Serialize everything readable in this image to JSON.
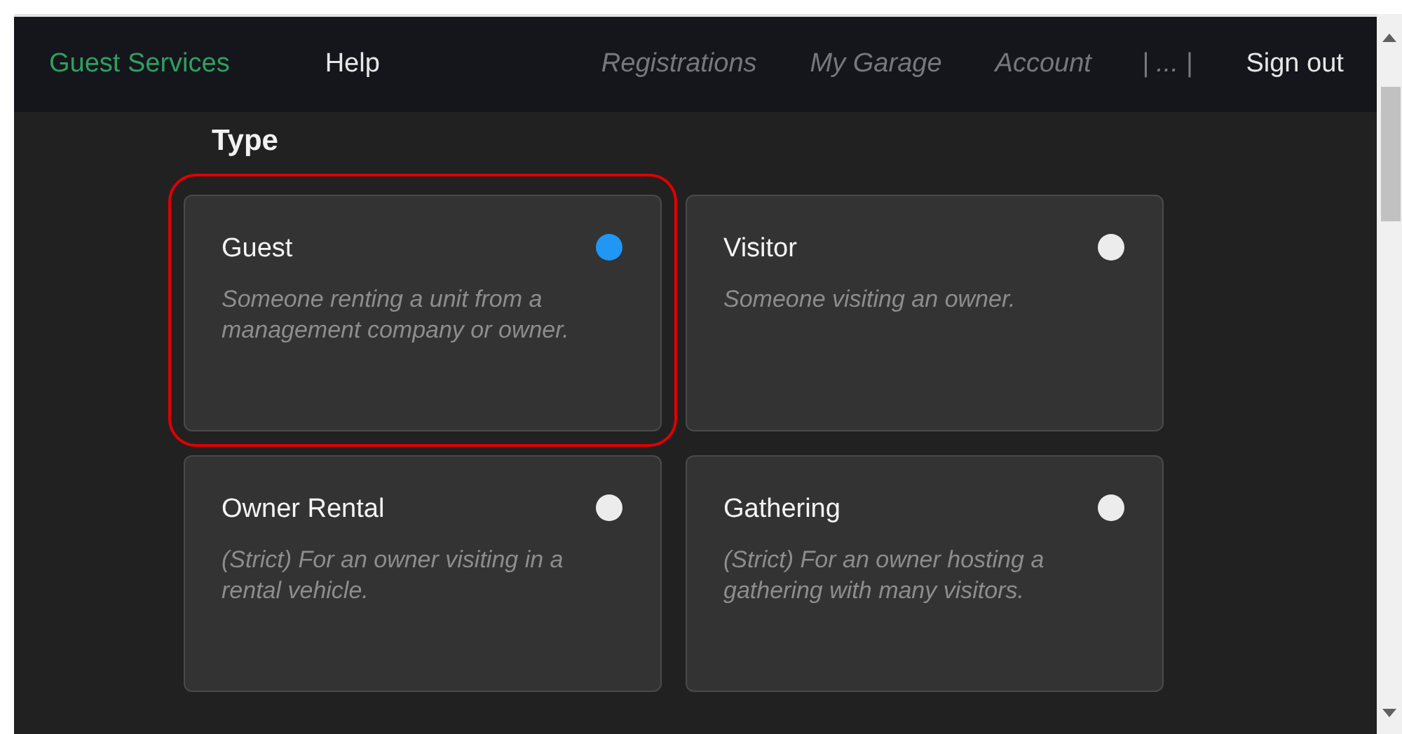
{
  "navbar": {
    "brand": "Guest Services",
    "links": [
      {
        "label": "Help",
        "disabled": false
      },
      {
        "label": "Registrations",
        "disabled": true
      },
      {
        "label": "My Garage",
        "disabled": true
      },
      {
        "label": "Account",
        "disabled": true
      },
      {
        "label": "| ... |",
        "disabled": true
      },
      {
        "label": "Sign out",
        "disabled": false
      }
    ]
  },
  "section": {
    "title": "Type"
  },
  "options": [
    {
      "title": "Guest",
      "description": "Someone renting a unit from a management company or owner.",
      "selected": true,
      "highlighted": true
    },
    {
      "title": "Visitor",
      "description": "Someone visiting an owner.",
      "selected": false,
      "highlighted": false
    },
    {
      "title": "Owner Rental",
      "description": "(Strict) For an owner visiting in a rental vehicle.",
      "selected": false,
      "highlighted": false
    },
    {
      "title": "Gathering",
      "description": "(Strict) For an owner hosting a gathering with many visitors.",
      "selected": false,
      "highlighted": false
    }
  ]
}
